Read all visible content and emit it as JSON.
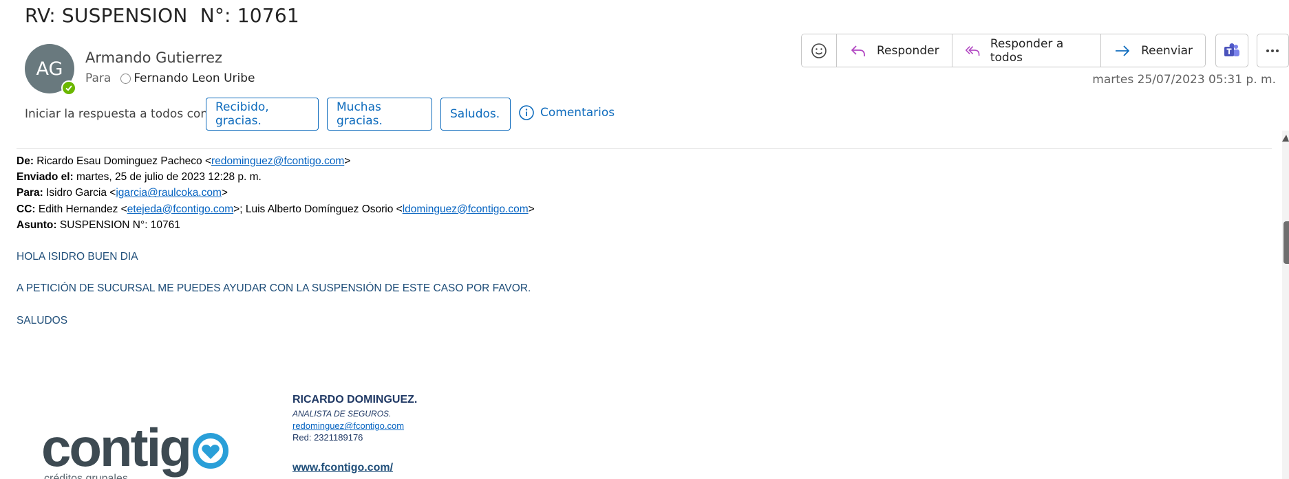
{
  "message": {
    "subject": "RV: SUSPENSION  N°: 10761",
    "avatar_initials": "AG",
    "sender_name": "Armando Gutierrez",
    "to_label": "Para",
    "to_name": "Fernando Leon Uribe",
    "date": "martes 25/07/2023 05:31 p. m."
  },
  "actions": {
    "reply": "Responder",
    "reply_all": "Responder a todos",
    "forward": "Reenviar"
  },
  "quick_replies": {
    "label": "Iniciar la respuesta a todos con:",
    "options": [
      "Recibido, gracias.",
      "Muchas gracias.",
      "Saludos."
    ],
    "comments": "Comentarios"
  },
  "forwarded": {
    "from_label": "De:",
    "from_name": "Ricardo Esau Dominguez Pacheco <",
    "from_email": "redominguez@fcontigo.com",
    "sent_label": "Enviado el:",
    "sent_value": "martes, 25 de julio de 2023 12:28 p. m.",
    "to_label": "Para:",
    "to_name": "Isidro Garcia <",
    "to_email": "igarcia@raulcoka.com",
    "cc_label": "CC:",
    "cc_name1": "Edith Hernandez <",
    "cc_email1": "etejeda@fcontigo.com",
    "cc_sep": ">; Luis Alberto Domínguez Osorio <",
    "cc_email2": "ldominguez@fcontigo.com",
    "subject_label": "Asunto:",
    "subject_value": "SUSPENSION N°: 10761",
    "close_bracket": ">"
  },
  "body": {
    "line1": "HOLA ISIDRO BUEN DIA",
    "line2": "A PETICIÓN DE SUCURSAL ME PUEDES AYUDAR CON LA SUSPENSIÓN DE ESTE CASO POR FAVOR.",
    "line3": "SALUDOS"
  },
  "signature": {
    "logo_word": "contig",
    "logo_tagline": "créditos grupales",
    "name": "RICARDO DOMINGUEZ.",
    "title": "ANALISTA DE SEGUROS.",
    "email": "redominguez@fcontigo.com",
    "phone": "Red: 2321189176",
    "website": "www.fcontigo.com/"
  },
  "colors": {
    "accent": "#0f6cbd",
    "avatar": "#69797e",
    "presence": "#6bb700",
    "reply_icon": "#b146c2",
    "body_text": "#1f4e79"
  },
  "icons": [
    "emoji-icon",
    "reply-icon",
    "reply-all-icon",
    "forward-icon",
    "teams-icon",
    "more-icon",
    "info-icon",
    "check-icon"
  ]
}
